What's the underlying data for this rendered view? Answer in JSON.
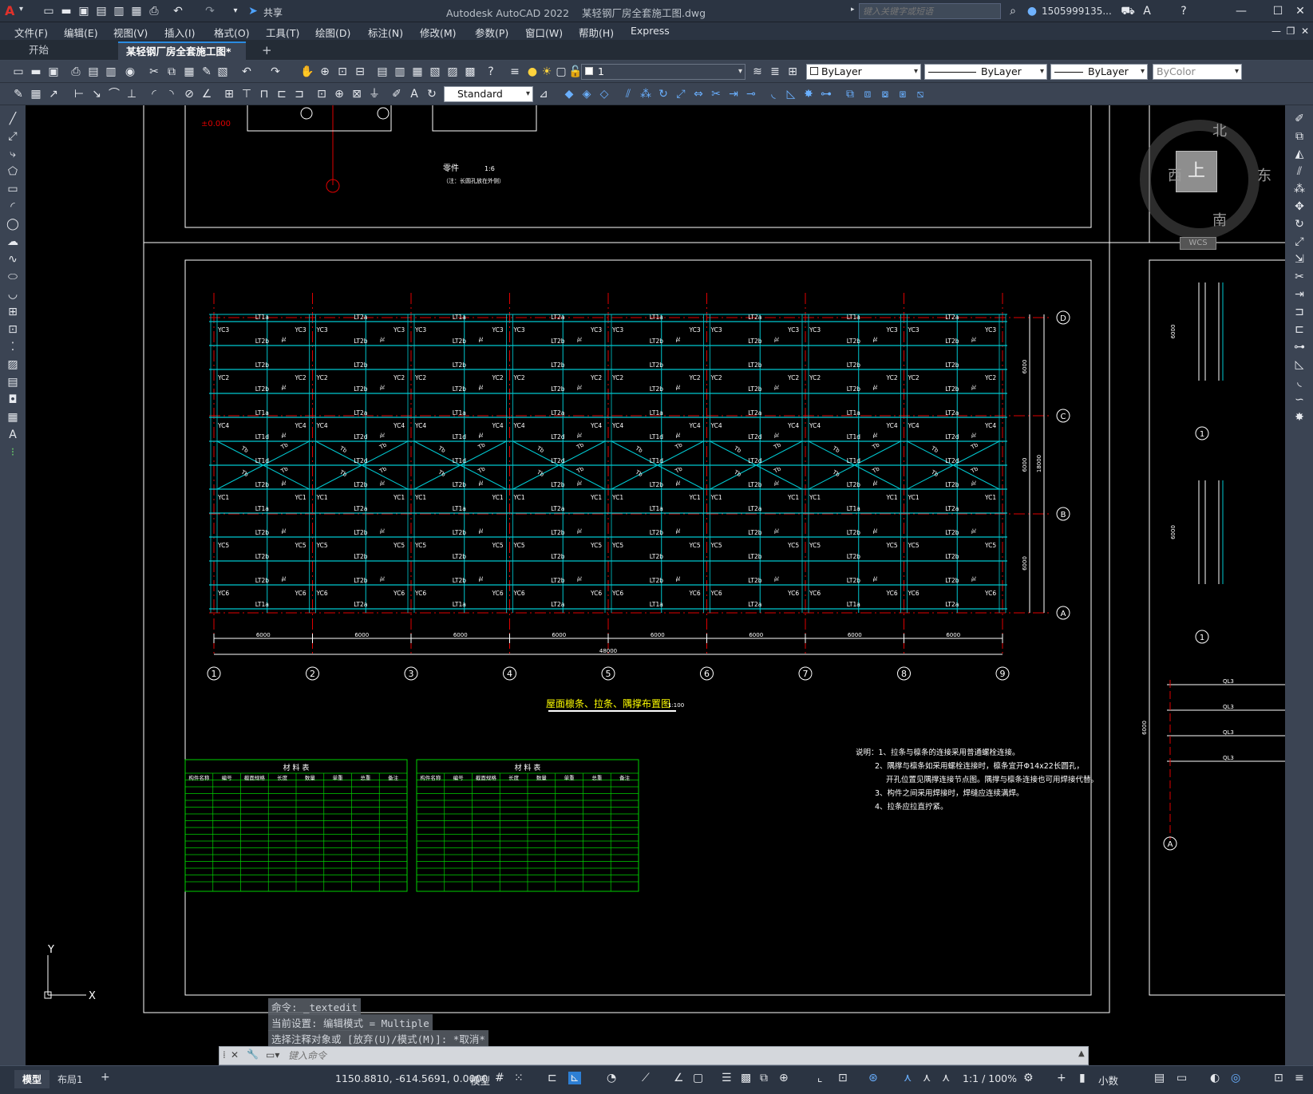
{
  "app": {
    "title": "Autodesk AutoCAD 2022",
    "document": "某轻钢厂房全套施工图.dwg",
    "share_label": "共享",
    "search_placeholder": "键入关键字或短语",
    "user": "1505999135...",
    "window_controls": [
      "minimize-icon",
      "maximize-icon",
      "close-icon"
    ]
  },
  "menu": {
    "items": [
      "文件(F)",
      "编辑(E)",
      "视图(V)",
      "插入(I)",
      "格式(O)",
      "工具(T)",
      "绘图(D)",
      "标注(N)",
      "修改(M)",
      "参数(P)",
      "窗口(W)",
      "帮助(H)",
      "Express"
    ]
  },
  "tabs": {
    "start": "开始",
    "drawing": "某轻钢厂房全套施工图*",
    "close": "✕",
    "new": "+"
  },
  "toolbar": {
    "layer_value": "1",
    "color_value": "ByLayer",
    "linetype_value": "ByLayer",
    "lineweight_value": "ByLayer",
    "plotstyle_value": "ByColor",
    "textstyle_value": "Standard"
  },
  "drawing": {
    "plan_title": "屋面檩条、拉条、隅撑布置图",
    "plan_scale": "1:100",
    "part_title": "零件",
    "part_scale": "1:6",
    "part_note": "（注：长圆孔放在外侧）",
    "elev_label": "±0.000",
    "grid_numbers": [
      "1",
      "2",
      "3",
      "4",
      "5",
      "6",
      "7",
      "8",
      "9"
    ],
    "grid_letters": [
      "D",
      "C",
      "B",
      "A"
    ],
    "bay_dim": "6000",
    "total_dim": "48000",
    "span_dim": "18000",
    "notes": [
      "说明：1、拉条与檩条的连接采用普通螺栓连接。",
      "2、隅撑与檩条如采用螺栓连接时，檩条宜开Φ14x22长圆孔，",
      "开孔位置见隅撑连接节点图。隅撑与檩条连接也可用焊接代替。",
      "3、构件之间采用焊接时，焊缝应连续满焊。",
      "4、拉条应拉直拧紧。"
    ],
    "table_title": "材 料 表",
    "table1_headers": [
      "构件名称",
      "编号",
      "截面规格",
      "长度",
      "数量",
      "单重",
      "总重",
      "备注"
    ],
    "table2_headers": [
      "构件名称",
      "编号",
      "截面规格",
      "长度",
      "数量",
      "单重",
      "总重",
      "备注"
    ],
    "purlin_labels": [
      "LT1a",
      "LT2a",
      "LT1b",
      "LT2b",
      "LT1c",
      "LT2c",
      "LT1d",
      "LT2d",
      "YC1",
      "YC2",
      "YC3",
      "YC4",
      "YC5",
      "YC6",
      "Ta",
      "Tb",
      "Tc"
    ],
    "right_labels": [
      "6000",
      "1500",
      "1500",
      "1200",
      "QL3",
      "6000",
      "1"
    ]
  },
  "compass": {
    "north": "北",
    "south": "南",
    "east": "东",
    "west": "西",
    "top": "上",
    "wcs": "WCS"
  },
  "command": {
    "history": [
      "命令: _textedit",
      "当前设置: 编辑模式 = Multiple",
      "选择注释对象或 [放弃(U)/模式(M)]: *取消*"
    ],
    "placeholder": "键入命令"
  },
  "status": {
    "model_tab": "模型",
    "layout_tab": "布局1",
    "coords": "1150.8810, -614.5691, 0.0000",
    "space": "模型",
    "scale": "1:1 / 100%",
    "units": "小数"
  },
  "colors": {
    "purlin": "#00c8d0",
    "grid": "#e00000",
    "table": "#00d000",
    "text": "#ffffff",
    "dim": "#ffffff",
    "highlight": "#ffff00"
  }
}
